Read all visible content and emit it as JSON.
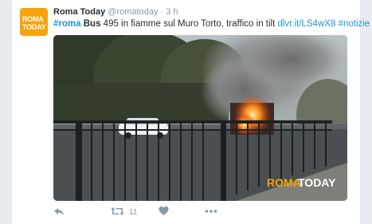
{
  "tweet": {
    "avatar_line1": "ROMA",
    "avatar_line2": "TODAY",
    "display_name": "Roma Today",
    "handle": "@romatoday",
    "separator": "·",
    "timestamp": "3 h",
    "hashtag_roma": "#roma",
    "bus_word": "Bus",
    "body": "495 in fiamme sul Muro Torto, traffico in tilt",
    "link": "dlvr.it/LS4wX8",
    "hashtag_notizie": "#notizie",
    "retweet_count": "11"
  },
  "media": {
    "watermark_roma": "ROMA",
    "watermark_today": "TODAY"
  },
  "colors": {
    "link": "#1b95e0",
    "brand": "#f7a30a",
    "secondary_text": "#8899a6"
  },
  "icons": [
    "reply-icon",
    "retweet-icon",
    "like-icon",
    "more-icon"
  ]
}
